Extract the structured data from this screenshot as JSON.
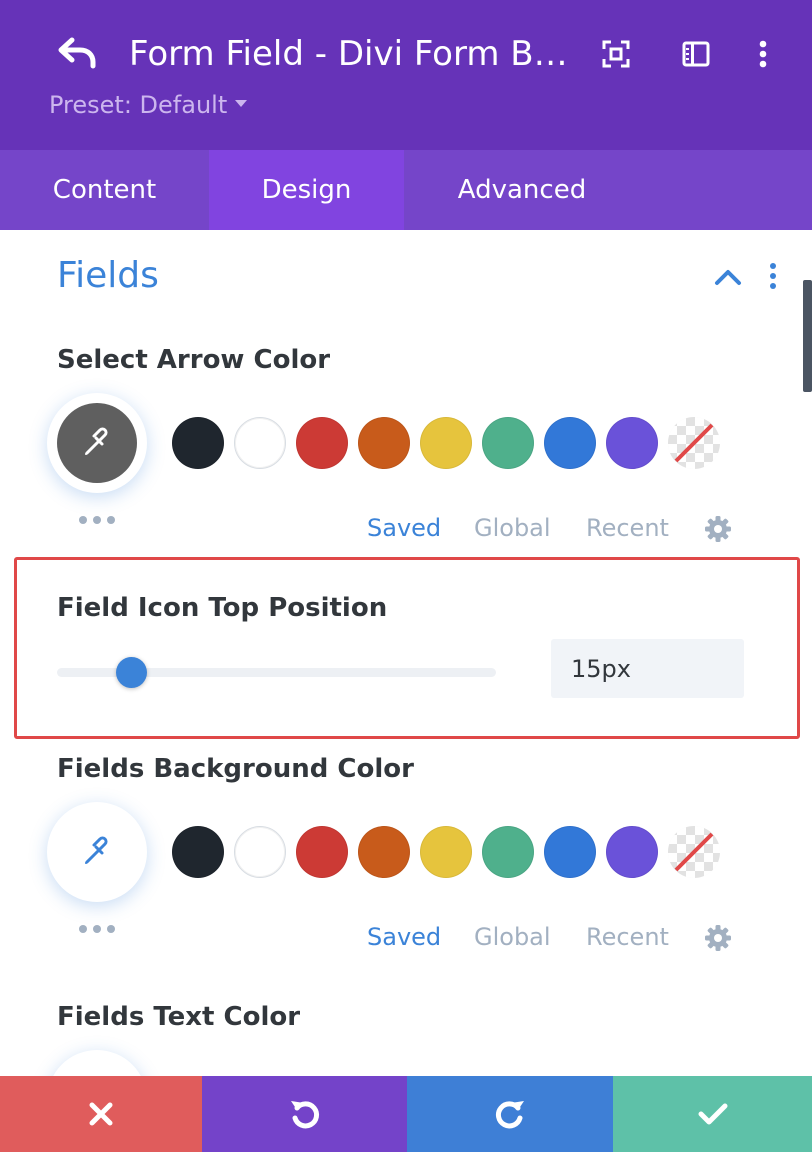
{
  "header": {
    "title": "Form Field - Divi Form Builder",
    "preset_label": "Preset: Default"
  },
  "tabs": [
    {
      "label": "Content",
      "active": false
    },
    {
      "label": "Design",
      "active": true
    },
    {
      "label": "Advanced",
      "active": false
    }
  ],
  "section": {
    "title": "Fields"
  },
  "select_arrow_color": {
    "label": "Select Arrow Color",
    "current_color": "#5f5f5f"
  },
  "field_icon_top_position": {
    "label": "Field Icon Top Position",
    "value": "15px",
    "slider_fraction": 0.17
  },
  "fields_background_color": {
    "label": "Fields Background Color",
    "current_color": "#ffffff"
  },
  "fields_text_color": {
    "label": "Fields Text Color"
  },
  "palette": [
    "#1f262e",
    "#ffffff",
    "#cc3a35",
    "#c85b1b",
    "#e6c43d",
    "#4fb08c",
    "#3278d8",
    "#6a52d9"
  ],
  "color_tabs": {
    "saved": "Saved",
    "global": "Global",
    "recent": "Recent"
  },
  "colors": {
    "header_bg": "#6633b8",
    "tabs_bg": "#7545c9",
    "active_tab_bg": "#8144e0",
    "accent": "#3b83d8",
    "highlight_border": "#e04848",
    "cancel": "#e05c5c",
    "undo": "#7443c9",
    "redo": "#3e7fd6",
    "save": "#5ec1a8"
  },
  "icons": {
    "back": "undo-arrow-icon",
    "focus": "focus-mode-icon",
    "sidebar": "sidebar-layout-icon",
    "menu": "vertical-dots-icon",
    "collapse": "chevron-up-icon",
    "eyedropper": "eyedropper-icon",
    "settings": "gear-icon",
    "cancel": "close-icon",
    "undo": "undo-icon",
    "redo": "redo-icon",
    "save": "checkmark-icon"
  }
}
